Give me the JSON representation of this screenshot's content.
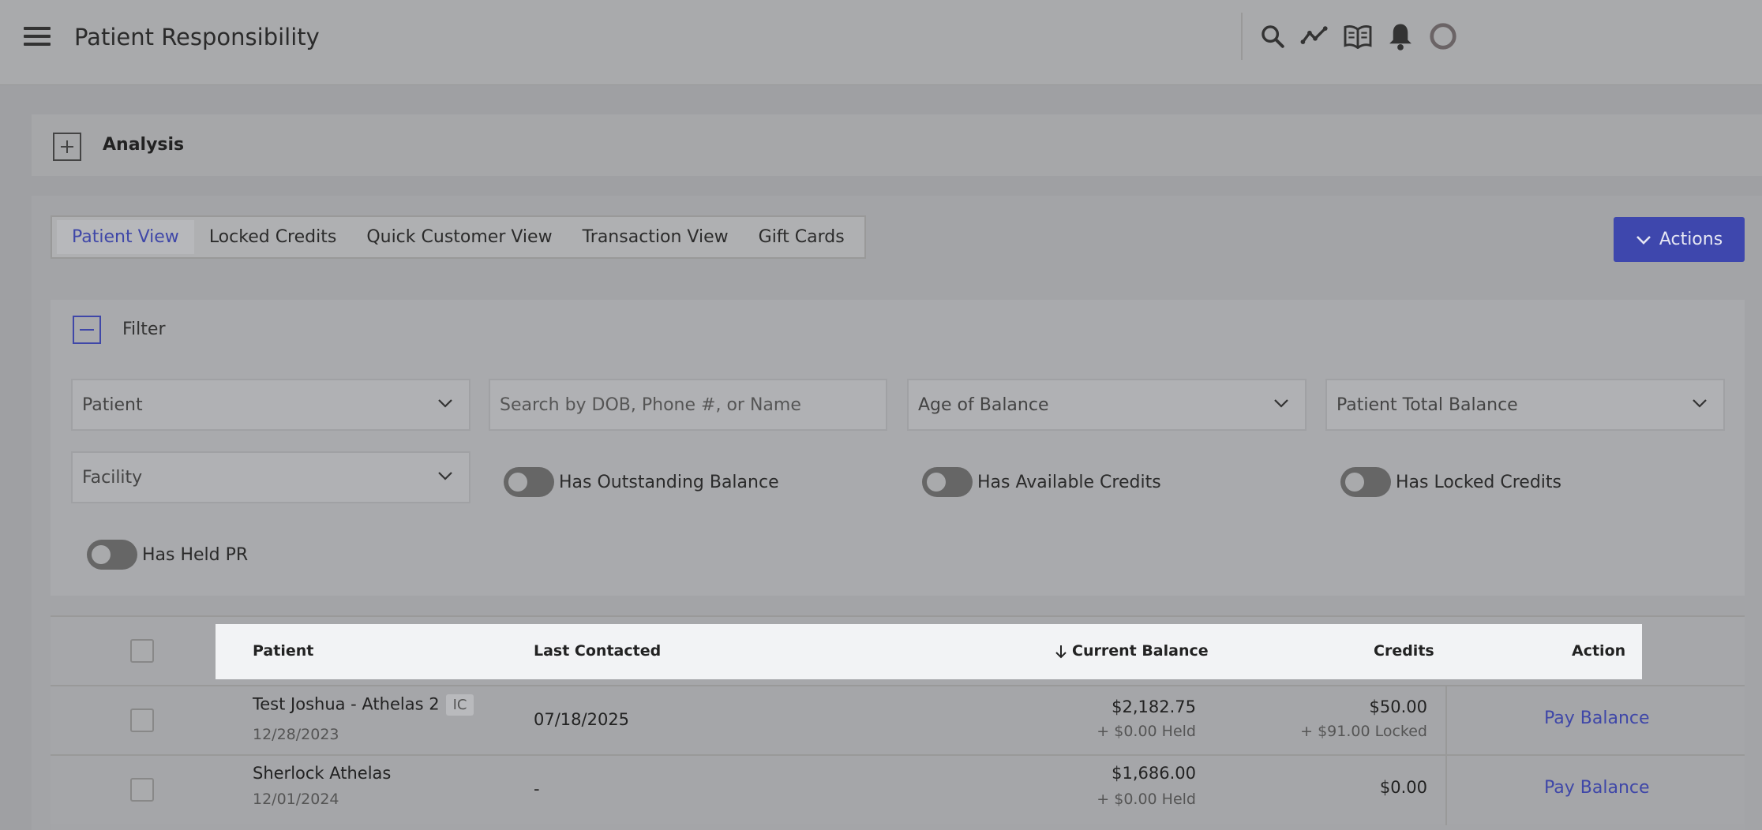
{
  "header": {
    "title": "Patient Responsibility",
    "icons": [
      "menu-icon",
      "search-icon",
      "chart-line-icon",
      "book-open-icon",
      "bell-icon",
      "loading-ring-icon"
    ]
  },
  "analysis": {
    "label": "Analysis"
  },
  "tabs": [
    {
      "label": "Patient View",
      "active": true
    },
    {
      "label": "Locked Credits",
      "active": false
    },
    {
      "label": "Quick Customer View",
      "active": false
    },
    {
      "label": "Transaction View",
      "active": false
    },
    {
      "label": "Gift Cards",
      "active": false
    }
  ],
  "actions": {
    "label": "Actions"
  },
  "filter": {
    "label": "Filter",
    "patient_select": "Patient",
    "search_placeholder": "Search by DOB, Phone #, or Name",
    "age_select": "Age of Balance",
    "total_select": "Patient Total Balance",
    "facility_select": "Facility",
    "toggles": {
      "outstanding": "Has Outstanding Balance",
      "available": "Has Available Credits",
      "locked": "Has Locked Credits",
      "held": "Has Held PR"
    }
  },
  "table": {
    "columns": {
      "patient": "Patient",
      "last_contacted": "Last Contacted",
      "current_balance": "Current Balance",
      "credits": "Credits",
      "action": "Action"
    },
    "rows": [
      {
        "name": "Test Joshua - Athelas 2",
        "badge": "IC",
        "date": "12/28/2023",
        "last_contacted": "07/18/2025",
        "balance": "$2,182.75",
        "held": "+ $0.00 Held",
        "credits": "$50.00",
        "credits_sub": "+ $91.00 Locked",
        "action": "Pay Balance"
      },
      {
        "name": "Sherlock Athelas",
        "date": "12/01/2024",
        "last_contacted": "-",
        "balance": "$1,686.00",
        "held": "+ $0.00 Held",
        "credits": "$0.00",
        "action": "Pay Balance"
      }
    ]
  },
  "colors": {
    "accent": "#3f47a8",
    "actions_bg": "#3e47ad"
  }
}
